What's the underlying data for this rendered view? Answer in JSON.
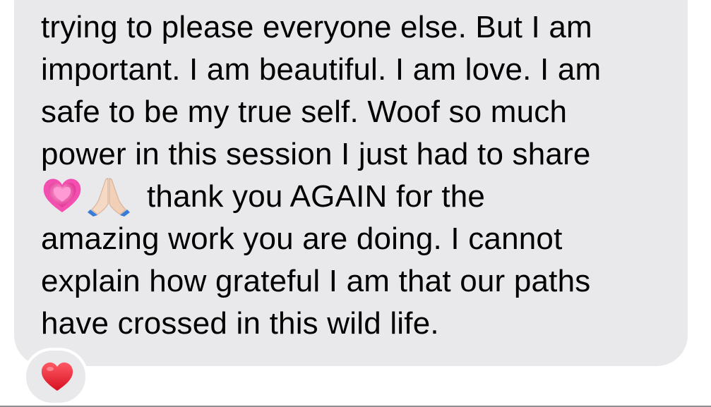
{
  "message": {
    "lines": [
      "trying to please everyone else. But I am",
      "important. I am beautiful. I am love. I am",
      "safe to be my true self. Woof so much",
      "power in this session I just had to share",
      "thank you AGAIN for the",
      "amazing work you are doing. I cannot",
      "explain how grateful I am that our paths",
      "have crossed in this wild life."
    ],
    "inline_emojis": [
      "growing-heart-icon",
      "folded-hands-icon"
    ]
  },
  "reaction": {
    "icon": "red-heart-icon",
    "color": "#ff2d3a"
  },
  "colors": {
    "bubble": "#e9e9eb",
    "text": "#000000"
  }
}
